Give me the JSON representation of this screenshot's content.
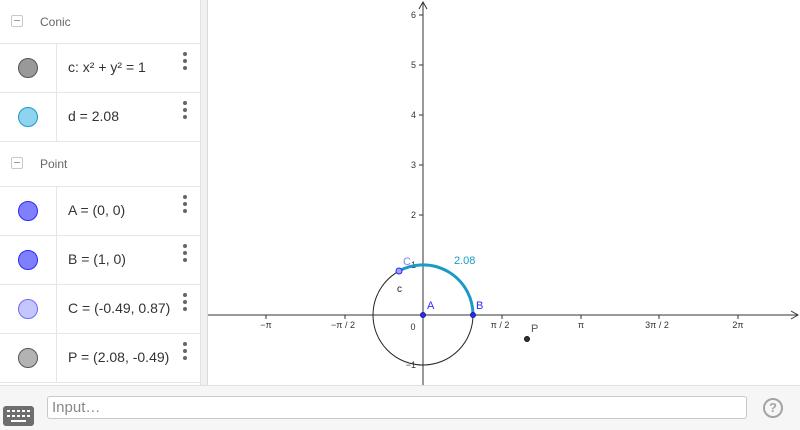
{
  "algebra": {
    "groups": [
      {
        "label": "Conic",
        "items": [
          {
            "text": "c: x² + y² = 1",
            "color": "#999999"
          },
          {
            "text": "d = 2.08",
            "color": "#8fd3ef"
          }
        ]
      },
      {
        "label": "Point",
        "items": [
          {
            "text": "A = (0, 0)",
            "color": "#8080ff"
          },
          {
            "text": "B = (1, 0)",
            "color": "#8080ff"
          },
          {
            "text": "C = (-0.49, 0.87)",
            "color": "#c6c6ff"
          },
          {
            "text": "P = (2.08, -0.49)",
            "color": "#b3b3b3"
          }
        ]
      }
    ]
  },
  "graphics": {
    "x_ticks": [
      "−π",
      "−π / 2",
      "0",
      "π / 2",
      "π",
      "3π / 2",
      "2π"
    ],
    "y_ticks": [
      "1",
      "2",
      "3",
      "4",
      "5",
      "6",
      "−1"
    ],
    "labels": {
      "A": "A",
      "B": "B",
      "C": "C",
      "P": "P",
      "c": "c",
      "arc": "2.08"
    },
    "colors": {
      "arc": "#1a9ac4",
      "point": "#2a2aff",
      "axis": "#333333"
    }
  },
  "input_bar": {
    "placeholder": "Input…",
    "help": "?"
  }
}
